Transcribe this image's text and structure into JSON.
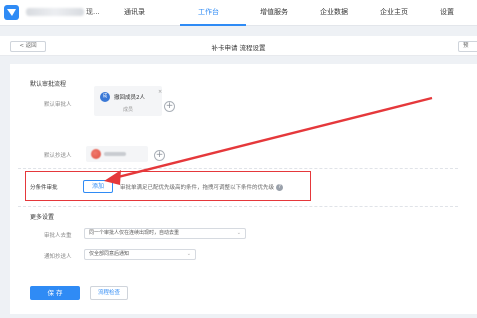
{
  "topnav": {
    "company_suffix": "现...",
    "items": [
      {
        "label": "通讯录"
      },
      {
        "label": "工作台"
      },
      {
        "label": "增值服务"
      },
      {
        "label": "企业数据"
      },
      {
        "label": "企业主页"
      },
      {
        "label": "设置"
      }
    ],
    "active_index": 1,
    "accent": "#2f8bf5"
  },
  "header": {
    "back_label": "< 返回",
    "title": "补卡申请 流程设置",
    "edge_button_label": "预"
  },
  "default_flow": {
    "title": "默认审批流程",
    "approver_label": "默认审批人",
    "approver_name": "撤回成员2人",
    "approver_avatar_text": "成",
    "approver_sub": "成员",
    "cc_label": "默认抄送人"
  },
  "branch": {
    "label": "分条件审批",
    "add_button": "添加",
    "hint": "审批单满足已配优先级高的条件，拖拽可调整以下条件的优先级",
    "highlight_color": "#e5383b"
  },
  "more_settings": {
    "title": "更多设置",
    "dedupe_label": "审批人去重",
    "dedupe_value": "同一个审批人仅在连续出现时，自动去重",
    "notify_label": "通知抄送人",
    "notify_value": "仅全部同意后通知"
  },
  "actions": {
    "save": "保 存",
    "check": "流程检查"
  }
}
